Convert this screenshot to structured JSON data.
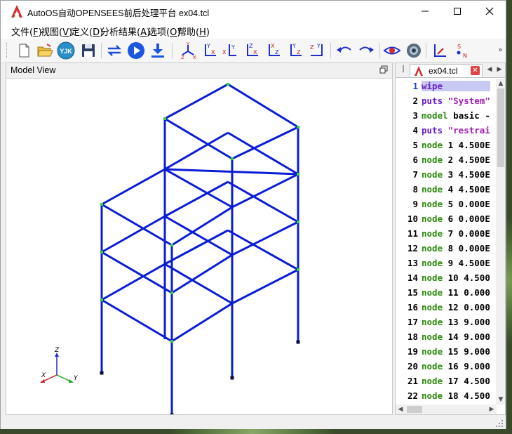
{
  "window": {
    "title": "AutoOS自动OPENSEES前后处理平台 ex04.tcl",
    "minimize_glyph": "—",
    "maximize_glyph": "☐",
    "close_glyph": "✕"
  },
  "menu": {
    "items": [
      {
        "label": "文件",
        "hotkey": "F"
      },
      {
        "label": "视图",
        "hotkey": "V"
      },
      {
        "label": "定义",
        "hotkey": "D"
      },
      {
        "label": "分析结果",
        "hotkey": "A"
      },
      {
        "label": "选项",
        "hotkey": "O"
      },
      {
        "label": "帮助",
        "hotkey": "H"
      }
    ]
  },
  "toolbar": {
    "buttons": [
      "new-file-icon",
      "open-folder-icon",
      "yjk-import-icon",
      "save-icon",
      "convert-icon",
      "run-icon",
      "download-icon",
      "view-3d-icon",
      "view-xy-icon",
      "view-xz-icon",
      "view-zx-icon",
      "view-zy-icon",
      "view-yz-icon",
      "view-zy2-icon",
      "undo-icon",
      "redo-icon",
      "eye-icon",
      "camera-icon",
      "axis-icon",
      "north-icon"
    ],
    "yjk_label": "YJK",
    "more_glyph": "»"
  },
  "model_view": {
    "title": "Model View",
    "axis_labels": {
      "z": "Z",
      "x": "X",
      "y": "Y"
    },
    "colors": {
      "frame": "#0a1cd6",
      "node_support": "#0a0a40",
      "node": "#30d040",
      "axis_x": "#c81e1e",
      "axis_y": "#20a020",
      "axis_z": "#1e2ec8"
    }
  },
  "editor": {
    "tab_label": "ex04.tcl",
    "tab_close_glyph": "✕",
    "tab_left_glyph": "◀",
    "tab_right_glyph": "▶",
    "lines": [
      {
        "num": "1",
        "kw": "wipe",
        "rest": ""
      },
      {
        "num": "2",
        "kw": "puts",
        "rest": " \"System\""
      },
      {
        "num": "3",
        "kw": "model",
        "rest": " basic -"
      },
      {
        "num": "4",
        "kw": "puts",
        "rest": " \"restrai"
      },
      {
        "num": "5",
        "kw": "node",
        "rest": " 1 4.500E"
      },
      {
        "num": "6",
        "kw": "node",
        "rest": " 2 4.500E"
      },
      {
        "num": "7",
        "kw": "node",
        "rest": " 3 4.500E"
      },
      {
        "num": "8",
        "kw": "node",
        "rest": " 4 4.500E"
      },
      {
        "num": "9",
        "kw": "node",
        "rest": " 5 0.000E"
      },
      {
        "num": "10",
        "kw": "node",
        "rest": " 6 0.000E"
      },
      {
        "num": "11",
        "kw": "node",
        "rest": " 7 0.000E"
      },
      {
        "num": "12",
        "kw": "node",
        "rest": " 8 0.000E"
      },
      {
        "num": "13",
        "kw": "node",
        "rest": " 9 4.500E"
      },
      {
        "num": "14",
        "kw": "node",
        "rest": " 10 4.500"
      },
      {
        "num": "15",
        "kw": "node",
        "rest": " 11 0.000"
      },
      {
        "num": "16",
        "kw": "node",
        "rest": " 12 0.000"
      },
      {
        "num": "17",
        "kw": "node",
        "rest": " 13 9.000"
      },
      {
        "num": "18",
        "kw": "node",
        "rest": " 14 9.000"
      },
      {
        "num": "19",
        "kw": "node",
        "rest": " 15 9.000"
      },
      {
        "num": "20",
        "kw": "node",
        "rest": " 16 9.000"
      },
      {
        "num": "21",
        "kw": "node",
        "rest": " 17 4.500"
      },
      {
        "num": "22",
        "kw": "node",
        "rest": " 18 4.500"
      }
    ]
  }
}
